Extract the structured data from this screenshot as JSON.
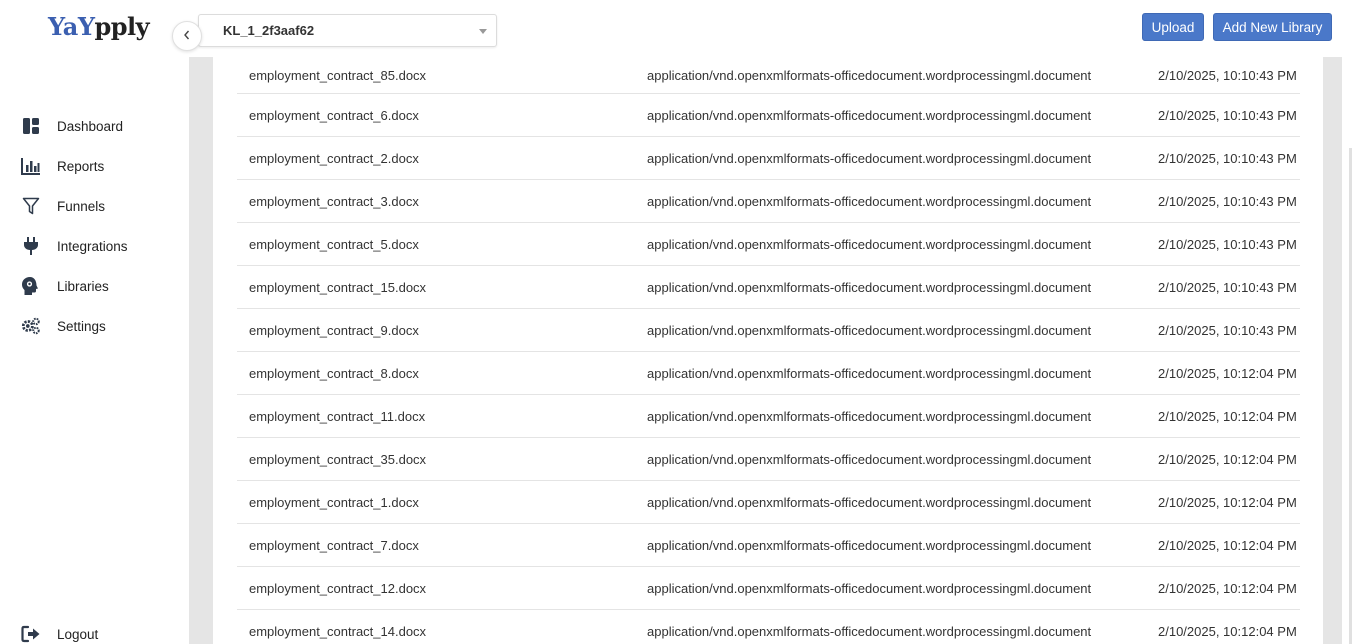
{
  "app": {
    "logo_part1": "Ya",
    "logo_part2": "Y",
    "logo_part3": "pply"
  },
  "sidebar": {
    "items": [
      {
        "label": "Dashboard",
        "icon": "dashboard-icon"
      },
      {
        "label": "Reports",
        "icon": "bar-chart-icon"
      },
      {
        "label": "Funnels",
        "icon": "funnel-icon"
      },
      {
        "label": "Integrations",
        "icon": "plug-icon"
      },
      {
        "label": "Libraries",
        "icon": "brain-icon"
      },
      {
        "label": "Settings",
        "icon": "gears-icon"
      }
    ],
    "logout": {
      "label": "Logout",
      "icon": "logout-icon"
    }
  },
  "header": {
    "library_select": "KL_1_2f3aaf62",
    "upload_label": "Upload",
    "add_library_label": "Add New Library"
  },
  "table": {
    "rows": [
      {
        "name": "employment_contract_85.docx",
        "type": "application/vnd.openxmlformats-officedocument.wordprocessingml.document",
        "date": "2/10/2025, 10:10:43 PM"
      },
      {
        "name": "employment_contract_6.docx",
        "type": "application/vnd.openxmlformats-officedocument.wordprocessingml.document",
        "date": "2/10/2025, 10:10:43 PM"
      },
      {
        "name": "employment_contract_2.docx",
        "type": "application/vnd.openxmlformats-officedocument.wordprocessingml.document",
        "date": "2/10/2025, 10:10:43 PM"
      },
      {
        "name": "employment_contract_3.docx",
        "type": "application/vnd.openxmlformats-officedocument.wordprocessingml.document",
        "date": "2/10/2025, 10:10:43 PM"
      },
      {
        "name": "employment_contract_5.docx",
        "type": "application/vnd.openxmlformats-officedocument.wordprocessingml.document",
        "date": "2/10/2025, 10:10:43 PM"
      },
      {
        "name": "employment_contract_15.docx",
        "type": "application/vnd.openxmlformats-officedocument.wordprocessingml.document",
        "date": "2/10/2025, 10:10:43 PM"
      },
      {
        "name": "employment_contract_9.docx",
        "type": "application/vnd.openxmlformats-officedocument.wordprocessingml.document",
        "date": "2/10/2025, 10:10:43 PM"
      },
      {
        "name": "employment_contract_8.docx",
        "type": "application/vnd.openxmlformats-officedocument.wordprocessingml.document",
        "date": "2/10/2025, 10:12:04 PM"
      },
      {
        "name": "employment_contract_11.docx",
        "type": "application/vnd.openxmlformats-officedocument.wordprocessingml.document",
        "date": "2/10/2025, 10:12:04 PM"
      },
      {
        "name": "employment_contract_35.docx",
        "type": "application/vnd.openxmlformats-officedocument.wordprocessingml.document",
        "date": "2/10/2025, 10:12:04 PM"
      },
      {
        "name": "employment_contract_1.docx",
        "type": "application/vnd.openxmlformats-officedocument.wordprocessingml.document",
        "date": "2/10/2025, 10:12:04 PM"
      },
      {
        "name": "employment_contract_7.docx",
        "type": "application/vnd.openxmlformats-officedocument.wordprocessingml.document",
        "date": "2/10/2025, 10:12:04 PM"
      },
      {
        "name": "employment_contract_12.docx",
        "type": "application/vnd.openxmlformats-officedocument.wordprocessingml.document",
        "date": "2/10/2025, 10:12:04 PM"
      },
      {
        "name": "employment_contract_14.docx",
        "type": "application/vnd.openxmlformats-officedocument.wordprocessingml.document",
        "date": "2/10/2025, 10:12:04 PM"
      }
    ]
  },
  "colors": {
    "accent": "#4a78c9",
    "logo_blue": "#3b5fb0",
    "background": "#e5e5e5"
  }
}
